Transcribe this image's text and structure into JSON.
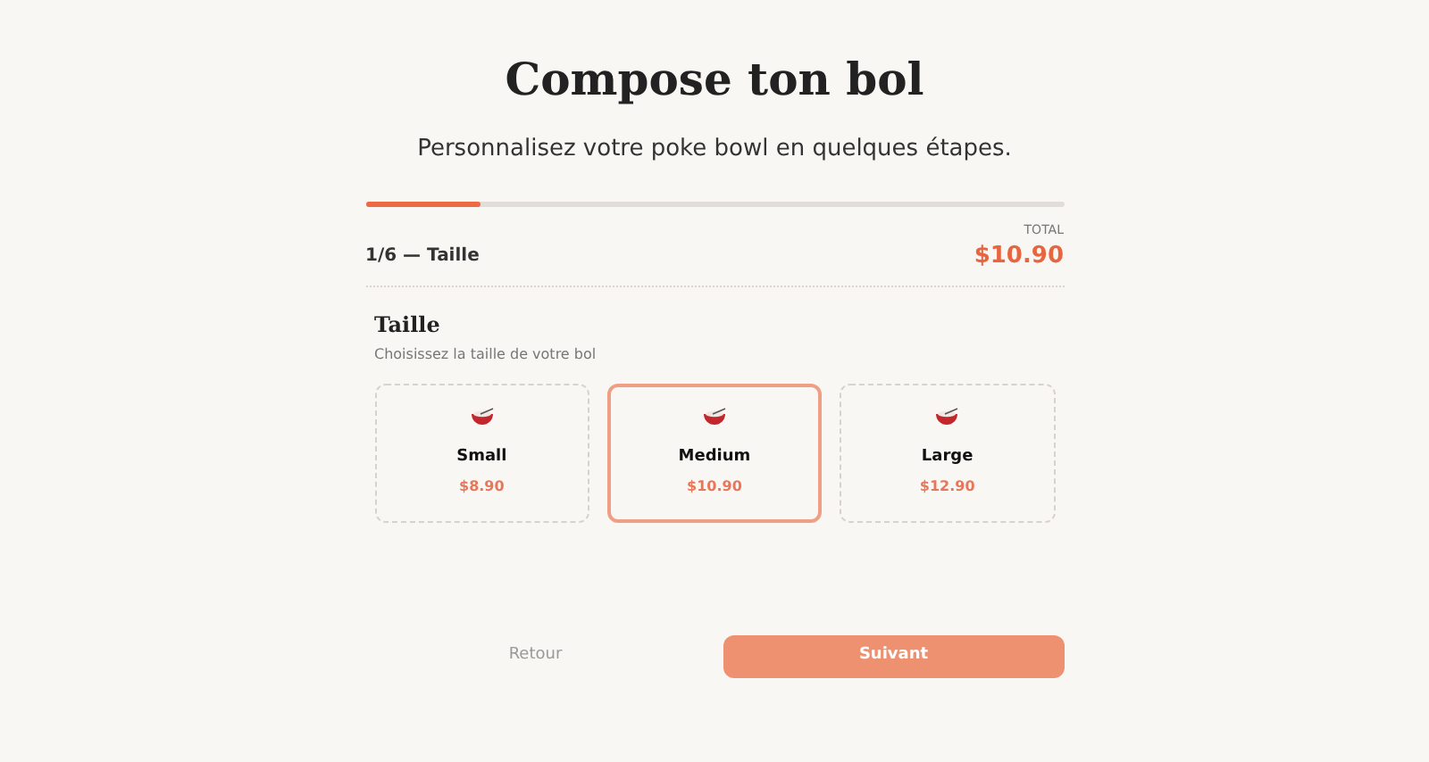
{
  "title": "Compose ton bol",
  "subtitle": "Personnalisez votre poke bowl en quelques étapes.",
  "progress": {
    "level": 0.166
  },
  "step": "1/6 — Taille",
  "total": {
    "label": "TOTAL",
    "value": "$10.90"
  },
  "section": {
    "title": "Taille",
    "hint": "Choisissez la taille de votre bol"
  },
  "options": [
    {
      "name": "Small",
      "price": "$8.90",
      "selected": false
    },
    {
      "name": "Medium",
      "price": "$10.90",
      "selected": true
    },
    {
      "name": "Large",
      "price": "$12.90",
      "selected": false
    }
  ],
  "back": {
    "label": "Retour",
    "disabled": true
  },
  "next": {
    "label": "Suivant"
  }
}
